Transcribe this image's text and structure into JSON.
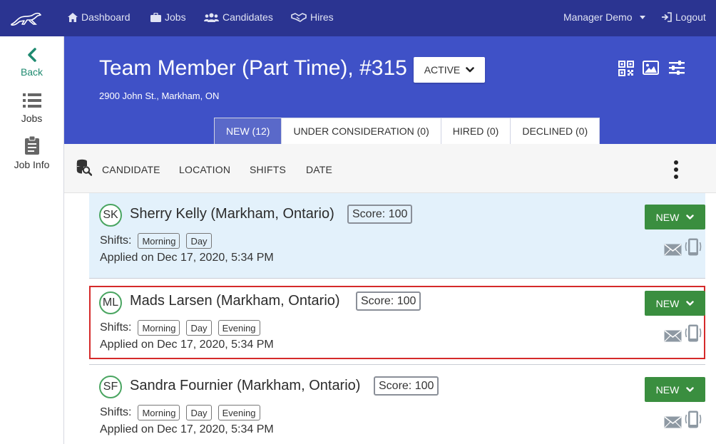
{
  "nav": {
    "logo_icon": "greyhound-logo-icon",
    "dashboard": "Dashboard",
    "jobs": "Jobs",
    "candidates": "Candidates",
    "hires": "Hires",
    "user_menu": "Manager Demo",
    "logout": "Logout"
  },
  "sidebar": {
    "back": "Back",
    "jobs": "Jobs",
    "job_info": "Job Info"
  },
  "job": {
    "title": "Team Member (Part Time), #315",
    "status": "ACTIVE",
    "address": "2900 John St., Markham, ON"
  },
  "header_icons": [
    "qr-code-icon",
    "image-icon",
    "sliders-icon"
  ],
  "tabs": [
    {
      "label": "NEW (12)",
      "active": true
    },
    {
      "label": "UNDER CONSIDERATION (0)",
      "active": false
    },
    {
      "label": "HIRED (0)",
      "active": false
    },
    {
      "label": "DECLINED (0)",
      "active": false
    }
  ],
  "filters": {
    "candidate": "CANDIDATE",
    "location": "LOCATION",
    "shifts": "SHIFTS",
    "date": "DATE"
  },
  "shifts_label": "Shifts:",
  "candidates": [
    {
      "initials": "SK",
      "name": "Sherry Kelly (Markham, Ontario)",
      "score": "Score: 100",
      "shifts": [
        "Morning",
        "Day"
      ],
      "applied": "Applied on Dec 17, 2020, 5:34 PM",
      "status": "NEW"
    },
    {
      "initials": "ML",
      "name": "Mads Larsen (Markham, Ontario)",
      "score": "Score: 100",
      "shifts": [
        "Morning",
        "Day",
        "Evening"
      ],
      "applied": "Applied on Dec 17, 2020, 5:34 PM",
      "status": "NEW"
    },
    {
      "initials": "SF",
      "name": "Sandra Fournier (Markham, Ontario)",
      "score": "Score: 100",
      "shifts": [
        "Morning",
        "Day",
        "Evening"
      ],
      "applied": "Applied on Dec 17, 2020, 5:34 PM",
      "status": "NEW"
    }
  ],
  "colors": {
    "nav_bg": "#2b3491",
    "header_bg": "#3f51c7",
    "active_tab": "#5a69c9",
    "status_green": "#3a8e3f",
    "highlight_row": "#e3f1fb",
    "outline_red": "#d52a2a",
    "back_teal": "#1f8a70"
  }
}
